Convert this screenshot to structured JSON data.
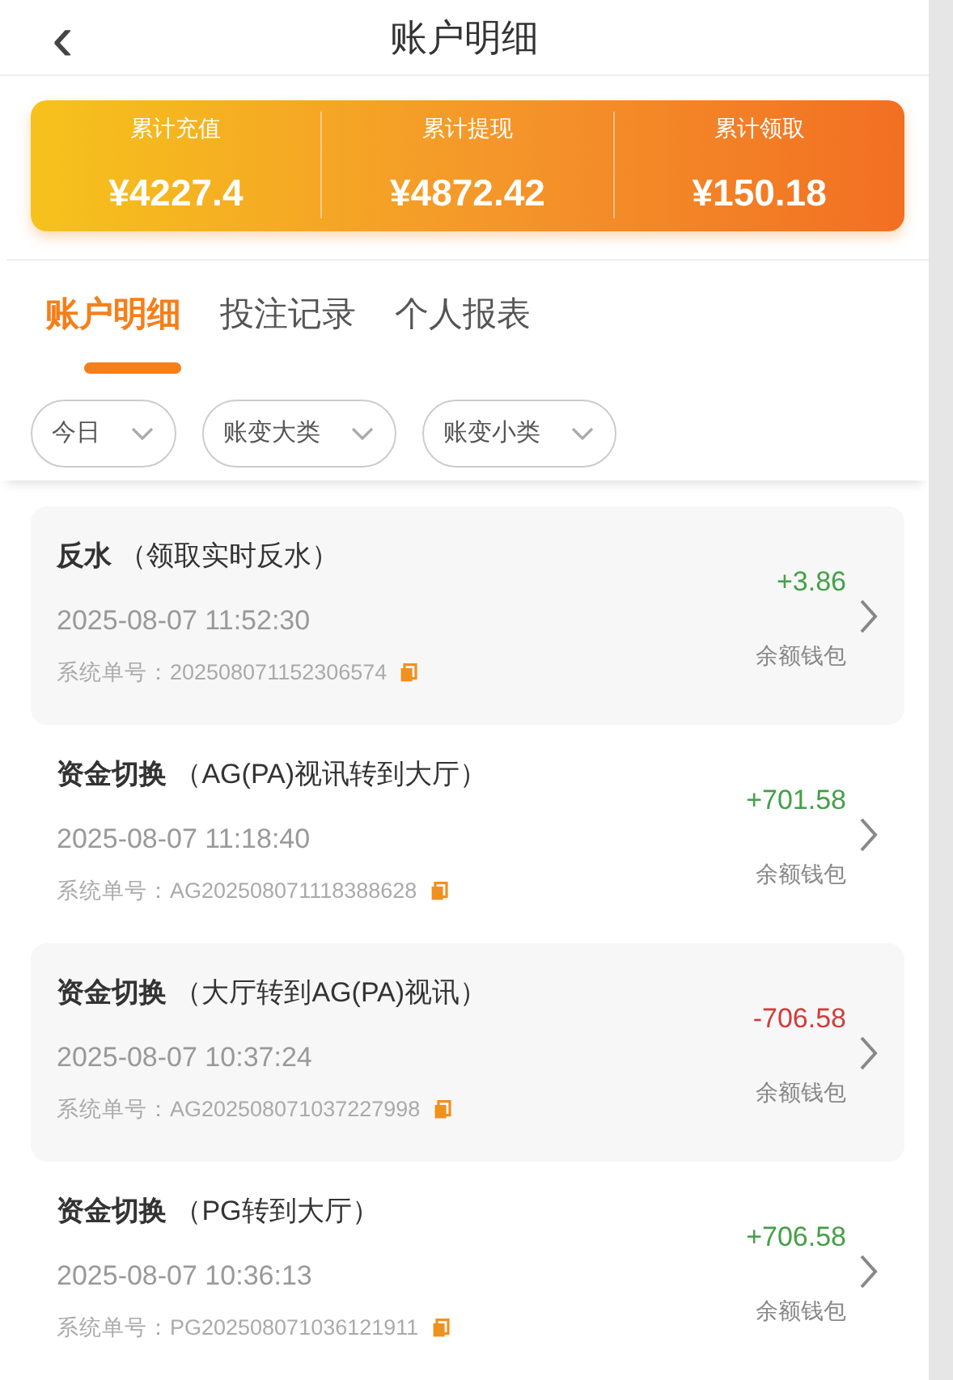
{
  "header": {
    "back": "‹",
    "title": "账户明细"
  },
  "summary": [
    {
      "label": "累计充值",
      "value": "¥4227.4"
    },
    {
      "label": "累计提现",
      "value": "¥4872.42"
    },
    {
      "label": "累计领取",
      "value": "¥150.18"
    }
  ],
  "tabs": [
    {
      "label": "账户明细",
      "selected": true
    },
    {
      "label": "投注记录",
      "selected": false
    },
    {
      "label": "个人报表",
      "selected": false
    }
  ],
  "filters": [
    {
      "label": "今日"
    },
    {
      "label": "账变大类"
    },
    {
      "label": "账变小类"
    }
  ],
  "records": [
    {
      "type": "反水",
      "detail": "（领取实时反水）",
      "time": "2025-08-07 11:52:30",
      "order_label": "系统单号：",
      "order_no": "202508071152306574",
      "amount": "+3.86",
      "kind": "credit",
      "wallet": "余额钱包"
    },
    {
      "type": "资金切换",
      "detail": "（AG(PA)视讯转到大厅）",
      "time": "2025-08-07 11:18:40",
      "order_label": "系统单号：",
      "order_no": "AG202508071118388628",
      "amount": "+701.58",
      "kind": "credit",
      "wallet": "余额钱包"
    },
    {
      "type": "资金切换",
      "detail": "（大厅转到AG(PA)视讯）",
      "time": "2025-08-07 10:37:24",
      "order_label": "系统单号：",
      "order_no": "AG202508071037227998",
      "amount": "-706.58",
      "kind": "debit",
      "wallet": "余额钱包"
    },
    {
      "type": "资金切换",
      "detail": "（PG转到大厅）",
      "time": "2025-08-07 10:36:13",
      "order_label": "系统单号：",
      "order_no": "PG202508071036121911",
      "amount": "+706.58",
      "kind": "credit",
      "wallet": "余额钱包"
    }
  ]
}
